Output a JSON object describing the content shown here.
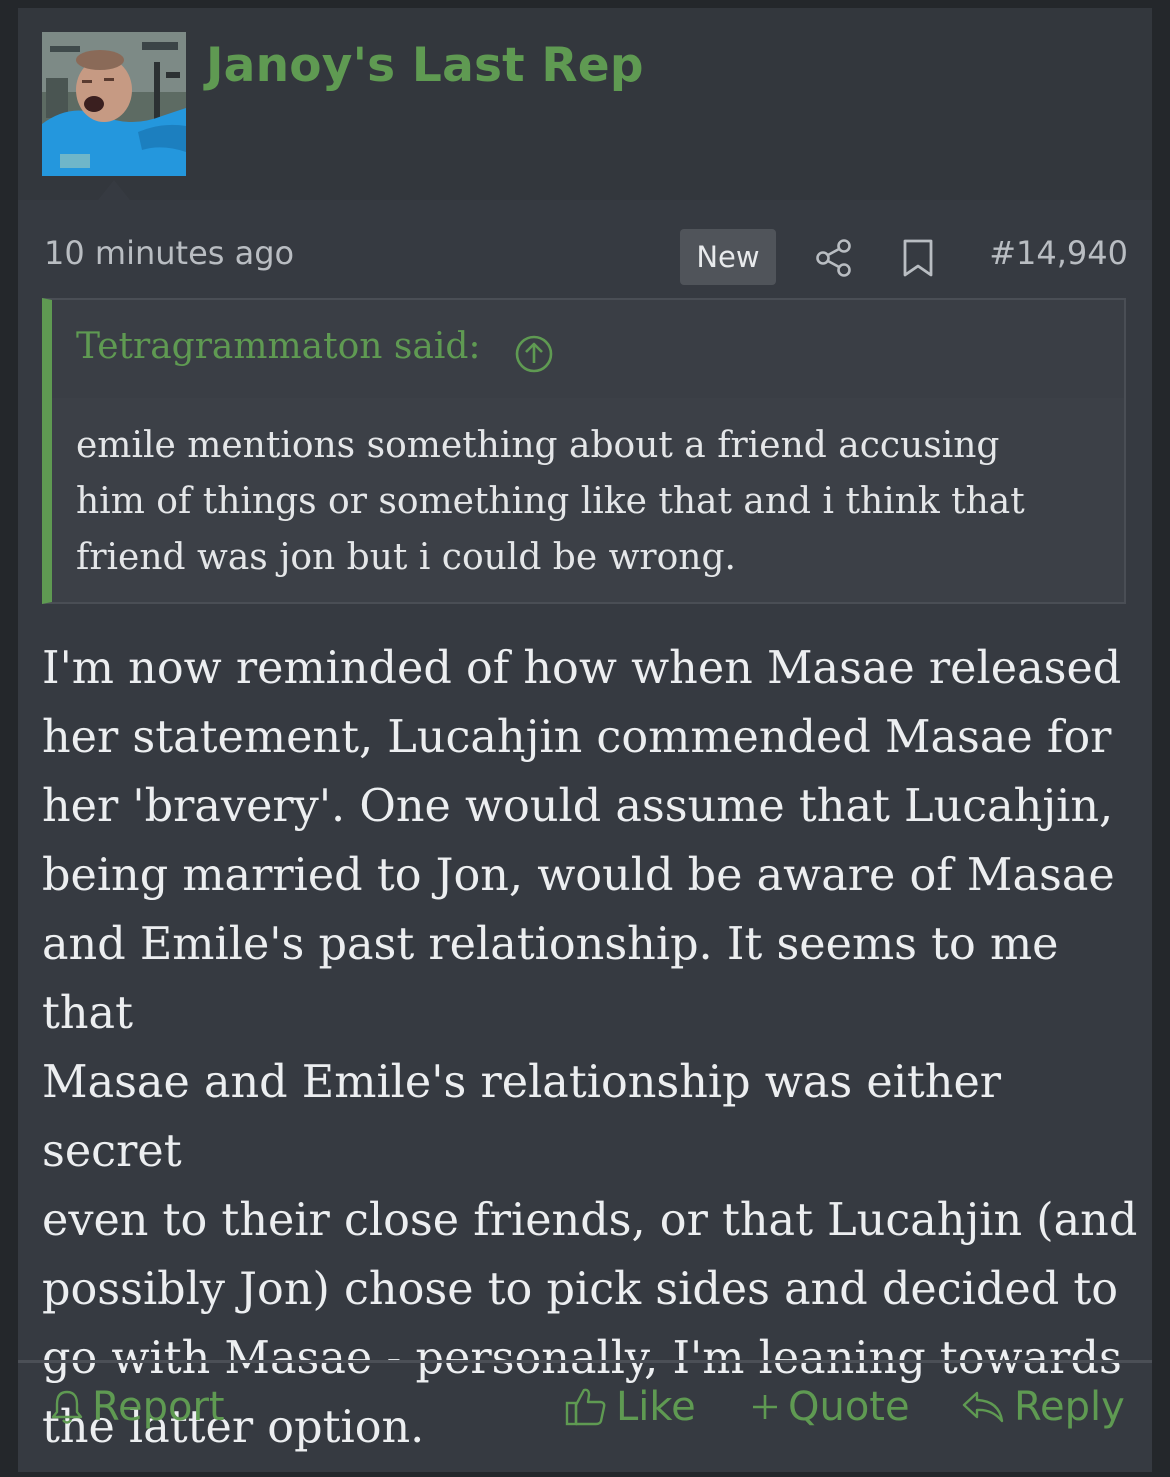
{
  "post": {
    "username": "Janoy's Last Rep",
    "time": "10 minutes ago",
    "badge": "New",
    "number": "#14,940"
  },
  "quote": {
    "attribution": "Tetragrammaton said:",
    "lines": [
      "emile mentions something about a friend accusing",
      "him of things or something like that and i think that",
      "friend was jon but i could be wrong."
    ]
  },
  "message": {
    "lines": [
      "I'm now reminded of how when Masae released",
      "her statement, Lucahjin commended Masae for",
      "her 'bravery'. One would assume that Lucahjin,",
      "being married to Jon, would be aware of Masae",
      "and Emile's past relationship. It seems to me that",
      "Masae and Emile's relationship was either secret",
      "even to their close friends, or that Lucahjin (and",
      "possibly Jon) chose to pick sides and decided to",
      "go with Masae - personally, I'm leaning towards",
      "the latter option."
    ]
  },
  "actions": {
    "report": "Report",
    "like": "Like",
    "quote": "Quote",
    "reply": "Reply"
  },
  "colors": {
    "accent": "#5f9a52",
    "background": "#363a41",
    "page": "#24272b"
  },
  "icons": [
    "share-icon",
    "bookmark-icon",
    "arrow-up-circle-icon",
    "bell-icon",
    "thumbs-up-icon",
    "plus-icon",
    "reply-arrow-icon"
  ]
}
